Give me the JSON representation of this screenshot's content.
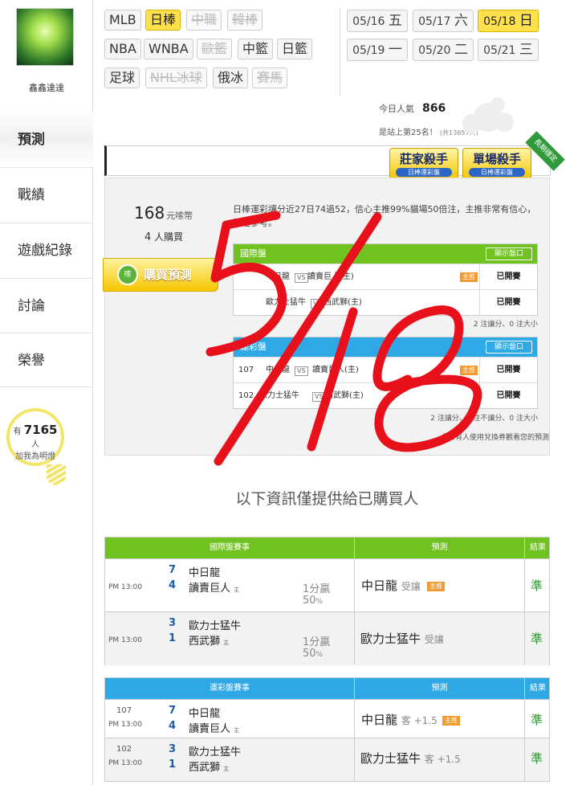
{
  "sidebar": {
    "username": "鑫鑫達達",
    "items": [
      {
        "label": "預測"
      },
      {
        "label": "戰績"
      },
      {
        "label": "遊戲紀錄"
      },
      {
        "label": "討論"
      },
      {
        "label": "榮譽"
      }
    ],
    "fans": {
      "prefix": "有",
      "count": "7165",
      "suffix": "人",
      "cta": "加我為明燈"
    }
  },
  "filters": {
    "row1": [
      {
        "label": "MLB"
      },
      {
        "label": "日棒"
      },
      {
        "label": "中職"
      },
      {
        "label": "韓棒"
      }
    ],
    "row2": [
      {
        "label": "NBA"
      },
      {
        "label": "WNBA"
      },
      {
        "label": "歐籃"
      },
      {
        "label": "中籃"
      },
      {
        "label": "日籃"
      }
    ],
    "row3": [
      {
        "label": "足球"
      },
      {
        "label": "NHL冰球"
      },
      {
        "label": "俄冰"
      },
      {
        "label": "賽馬"
      }
    ]
  },
  "dates": [
    {
      "date": "05/16",
      "day": "五"
    },
    {
      "date": "05/17",
      "day": "六"
    },
    {
      "date": "05/18",
      "day": "日"
    },
    {
      "date": "05/19",
      "day": "一"
    },
    {
      "date": "05/20",
      "day": "二"
    },
    {
      "date": "05/21",
      "day": "三"
    }
  ],
  "popularity": {
    "label": "今日人氣",
    "value": "866",
    "rank_text": "是站上第25名！",
    "rank_sub": "(共13657人)"
  },
  "badges": {
    "b1": "莊家殺手",
    "b1_sub": "日棒運彩盤",
    "b2": "單場殺手",
    "b2_sub": "日棒運彩盤",
    "ribbon": "長期穩定"
  },
  "prediction": {
    "price": "168",
    "price_unit": "元嗦幣",
    "buyers_count": "4",
    "buyers_label": "人購買",
    "buy_button": "購買預測",
    "coin_label": "嗦",
    "description": "日棒運彩讓分近27日74過52，信心主推99%貓場50倍注，主推非常有信心，歡迎參考。",
    "intl": {
      "title": "國際盤",
      "show_button": "顯示盤口",
      "rows": [
        {
          "away": "中日龍",
          "home": "讀賣巨人(主)",
          "tag": "主推",
          "status": "已開賽"
        },
        {
          "away": "歐力士猛牛",
          "home": "西武獅(主)",
          "tag": "",
          "status": "已開賽"
        }
      ],
      "stat": "2 注讓分、0 注大小"
    },
    "sport": {
      "title": "運彩盤",
      "show_button": "顯示盤口",
      "rows": [
        {
          "code": "107",
          "away": "中日龍",
          "home": "讀賣巨人(主)",
          "tag": "主推",
          "status": "已開賽"
        },
        {
          "code": "102",
          "away": "歐力士猛牛",
          "home": "西武獅(主)",
          "tag": "",
          "status": "已開賽"
        }
      ],
      "stat": "2 注讓分、0 注不讓分、0 注大小",
      "note": "今日有人使用兌換券觀看您的預測"
    }
  },
  "notice": "以下資訊僅提供給已購買人",
  "intl_results": {
    "headers": {
      "event": "國際盤賽事",
      "pick": "預測",
      "result": "結果"
    },
    "rows": [
      {
        "time": "PM 13:00",
        "s1": "7",
        "s2": "4",
        "t1": "中日龍",
        "t2": "讀賣巨人",
        "t2_tag": "主",
        "hcap": "1分贏",
        "pct": "50",
        "pct_unit": "%",
        "pick": "中日龍",
        "pick_note": "受讓",
        "pick_tag": "主推",
        "result": "準"
      },
      {
        "time": "PM 13:00",
        "s1": "3",
        "s2": "1",
        "t1": "歐力士猛牛",
        "t2": "西武獅",
        "t2_tag": "主",
        "hcap": "1分贏",
        "pct": "50",
        "pct_unit": "%",
        "pick": "歐力士猛牛",
        "pick_note": "受讓",
        "pick_tag": "",
        "result": "準"
      }
    ]
  },
  "sport_results": {
    "headers": {
      "event": "運彩盤賽事",
      "pick": "預測",
      "result": "結果"
    },
    "rows": [
      {
        "code": "107",
        "time": "PM 13:00",
        "s1": "7",
        "s2": "4",
        "t1": "中日龍",
        "t2": "讀賣巨人",
        "t2_tag": "主",
        "pick": "中日龍",
        "pick_note": "客 +1.5",
        "pick_tag": "主推",
        "result": "準"
      },
      {
        "code": "102",
        "time": "PM 13:00",
        "s1": "3",
        "s2": "1",
        "t1": "歐力士猛牛",
        "t2": "西武獅",
        "t2_tag": "主",
        "pick": "歐力士猛牛",
        "pick_note": "客 +1.5",
        "pick_tag": "",
        "result": "準"
      }
    ]
  },
  "handwriting": "5/18",
  "colors": {
    "accent_yellow": "#ffe14d",
    "intl_green": "#6fc21f",
    "sport_blue": "#2fa8e6",
    "ink_red": "#e8101a",
    "win_green": "#2a9a30"
  }
}
